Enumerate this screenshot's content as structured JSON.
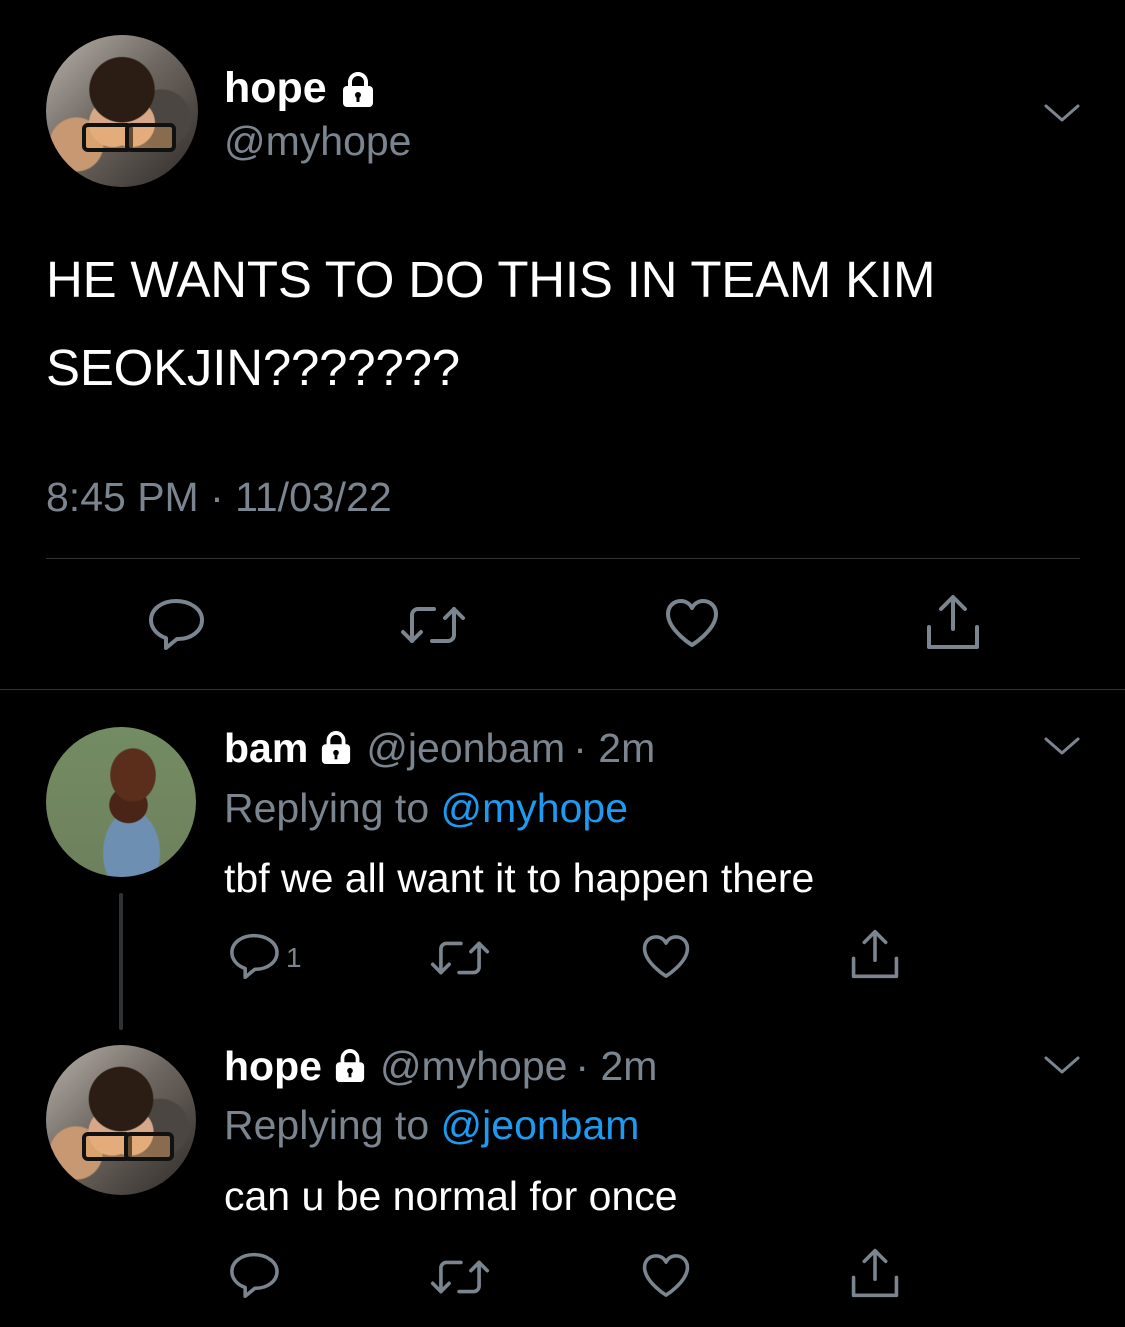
{
  "main_tweet": {
    "name": "hope",
    "handle": "@myhope",
    "text_line1": "HE WANTS TO DO THIS IN TEAM KIM",
    "text_line2": "SEOKJIN???????",
    "timestamp": "8:45 PM · 11/03/22"
  },
  "reply1": {
    "name": "bam",
    "handle": "@jeonbam",
    "time": "· 2m",
    "replying_prefix": "Replying to",
    "replying_to": "@myhope",
    "text": "tbf we all want it to happen there",
    "reply_count": "1"
  },
  "reply2": {
    "name": "hope",
    "handle": "@myhope",
    "time": "· 2m",
    "replying_prefix": "Replying to",
    "replying_to": "@jeonbam",
    "text": "can u be normal for once"
  },
  "icons": {
    "lock": "lock-icon",
    "chevron": "chevron-down-icon",
    "reply": "reply-icon",
    "retweet": "retweet-icon",
    "like": "heart-icon",
    "share": "share-icon"
  },
  "colors": {
    "background": "#000000",
    "text": "#ffffff",
    "muted": "#7b8590",
    "link": "#1d9bf0",
    "divider": "#2f3336"
  }
}
